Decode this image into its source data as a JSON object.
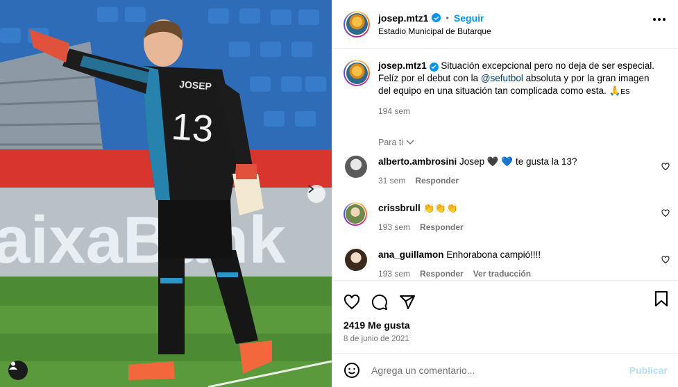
{
  "post": {
    "username": "josep.mtz1",
    "follow_label": "Seguir",
    "separator": "•",
    "location": "Estadio Municipal de Butarque"
  },
  "photo": {
    "jersey_name": "JOSEP",
    "jersey_number": "13",
    "ad_text": "aixaBank"
  },
  "caption": {
    "username": "josep.mtz1",
    "text_1": "Situación excepcional pero no deja de ser especial. Felíz por el debut con la ",
    "mention": "@sefutbol",
    "text_2": " absoluta y por la gran imagen del equipo en una situación tan complicada como esta. 🙏",
    "text_3": "ES",
    "time": "194 sem"
  },
  "para_ti": "Para ti",
  "comments": [
    {
      "username": "alberto.ambrosini",
      "text": "Josep 🖤 💙 te gusta la 13?",
      "time": "31 sem",
      "reply": "Responder"
    },
    {
      "username": "crissbrull",
      "text": "👏👏👏",
      "time": "193 sem",
      "reply": "Responder"
    },
    {
      "username": "ana_guillamon",
      "text": "Enhorabona campió!!!!",
      "time": "193 sem",
      "reply": "Responder",
      "translate": "Ver traducción"
    }
  ],
  "likes": "2419 Me gusta",
  "date": "8 de junio de 2021",
  "add_comment": {
    "placeholder": "Agrega un comentario...",
    "publish": "Publicar"
  },
  "colors": {
    "accent": "#0095f6",
    "muted": "#737373",
    "publish_disabled": "#b2dffc",
    "mention": "#00376b"
  }
}
